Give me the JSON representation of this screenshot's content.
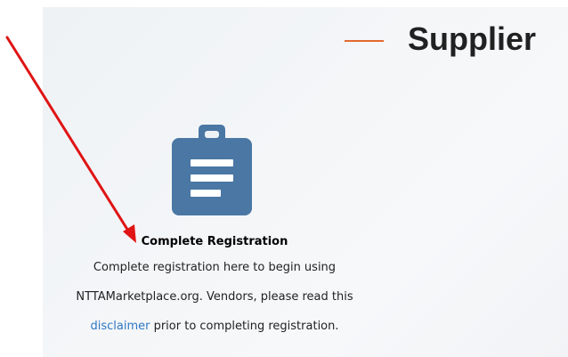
{
  "header": {
    "title": "Supplier"
  },
  "card": {
    "icon": "clipboard-icon",
    "title": "Complete Registration",
    "line1": "Complete registration here to begin using",
    "line2": "NTTAMarketplace.org. Vendors, please read this",
    "link_text": "disclaimer",
    "line3_suffix": " prior to completing registration."
  },
  "colors": {
    "accent_dash": "#e2692f",
    "icon_blue": "#4a77a4",
    "link_blue": "#2f78c4",
    "arrow_red": "#e01414"
  }
}
